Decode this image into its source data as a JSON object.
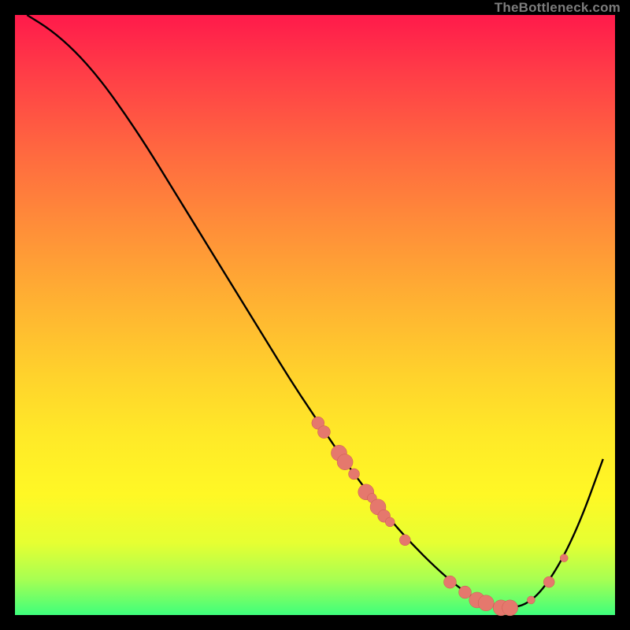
{
  "watermark": "TheBottleneck.com",
  "colors": {
    "curve_stroke": "#000000",
    "point_fill": "#e5786d",
    "point_stroke": "#c95a50"
  },
  "chart_data": {
    "type": "line",
    "title": "",
    "xlabel": "",
    "ylabel": "",
    "xlim": [
      0,
      100
    ],
    "ylim": [
      0,
      100
    ],
    "grid": false,
    "series": [
      {
        "name": "bottleneck-curve",
        "x": [
          2,
          6,
          10,
          14,
          18,
          22,
          26,
          30,
          34,
          38,
          42,
          46,
          50,
          54,
          58,
          62,
          66,
          70,
          74,
          78,
          82,
          86,
          90,
          94,
          98
        ],
        "y": [
          100,
          97.5,
          94,
          89.5,
          84,
          78,
          71.5,
          65,
          58.5,
          52,
          45.5,
          39,
          33,
          27,
          21.5,
          16.5,
          12,
          8,
          4.5,
          2,
          1,
          2,
          7,
          15,
          26
        ]
      }
    ],
    "highlight_points": {
      "name": "sample-points",
      "points": [
        {
          "x": 50.5,
          "y": 32,
          "r": 8
        },
        {
          "x": 51.5,
          "y": 30.5,
          "r": 8
        },
        {
          "x": 54,
          "y": 27,
          "r": 10
        },
        {
          "x": 55,
          "y": 25.5,
          "r": 10
        },
        {
          "x": 56.5,
          "y": 23.5,
          "r": 7
        },
        {
          "x": 58.5,
          "y": 20.5,
          "r": 10
        },
        {
          "x": 59.5,
          "y": 19.5,
          "r": 6
        },
        {
          "x": 60.5,
          "y": 18,
          "r": 10
        },
        {
          "x": 61.5,
          "y": 16.5,
          "r": 8
        },
        {
          "x": 62.5,
          "y": 15.5,
          "r": 6
        },
        {
          "x": 65,
          "y": 12.5,
          "r": 7
        },
        {
          "x": 72.5,
          "y": 5.5,
          "r": 8
        },
        {
          "x": 75,
          "y": 3.8,
          "r": 8
        },
        {
          "x": 77,
          "y": 2.5,
          "r": 10
        },
        {
          "x": 78.5,
          "y": 2,
          "r": 10
        },
        {
          "x": 81,
          "y": 1.2,
          "r": 10
        },
        {
          "x": 82.5,
          "y": 1.2,
          "r": 10
        },
        {
          "x": 86,
          "y": 2.5,
          "r": 5
        },
        {
          "x": 89,
          "y": 5.5,
          "r": 7
        },
        {
          "x": 91.5,
          "y": 9.5,
          "r": 5
        }
      ]
    }
  }
}
